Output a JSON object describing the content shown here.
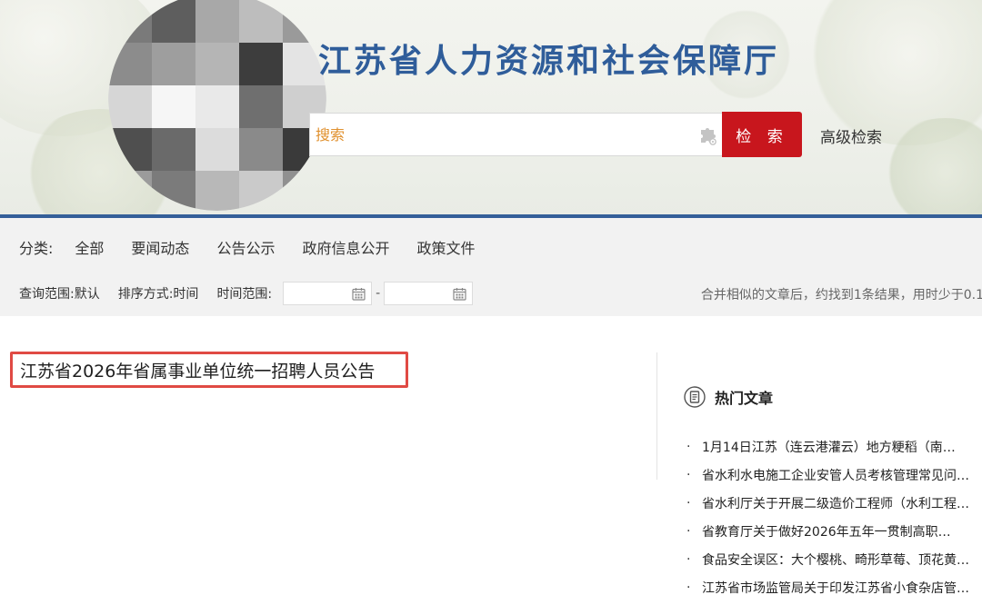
{
  "header": {
    "site_title": "江苏省人力资源和社会保障厅",
    "search": {
      "placeholder": "搜索",
      "button_label": "检 索",
      "advanced_label": "高级检索"
    },
    "logo_colors": [
      "#7a7a7a",
      "#5e5e5e",
      "#a8a8a8",
      "#bdbdbd",
      "#9a9a9a",
      "#8c8c8c",
      "#9e9e9e",
      "#b5b5b5",
      "#3d3d3d",
      "#e4e4e4",
      "#d6d6d6",
      "#f6f6f6",
      "#e9e9e9",
      "#6f6f6f",
      "#cfcfcf",
      "#4f4f4f",
      "#6a6a6a",
      "#dcdcdc",
      "#8a8a8a",
      "#3a3a3a",
      "#9b9b9b",
      "#7b7b7b",
      "#b8b8b8",
      "#cacaca",
      "#909090"
    ]
  },
  "filters": {
    "category_label": "分类:",
    "categories": [
      "全部",
      "要闻动态",
      "公告公示",
      "政府信息公开",
      "政策文件"
    ],
    "scope_label": "查询范围:默认",
    "sort_label": "排序方式:时间",
    "time_label": "时间范围:",
    "date_separator": "-",
    "result_summary": "合并相似的文章后，约找到1条结果，用时少于0.1"
  },
  "results": [
    {
      "title": "江苏省2026年省属事业单位统一招聘人员公告"
    }
  ],
  "hot_articles": {
    "title": "热门文章",
    "bullet": "·",
    "items": [
      "1月14日江苏（连云港灌云）地方粳稻（南…",
      "省水利水电施工企业安管人员考核管理常见问…",
      "省水利厅关于开展二级造价工程师（水利工程…",
      "省教育厅关于做好2026年五年一贯制高职…",
      "食品安全误区：大个樱桃、畸形草莓、顶花黄…",
      "江苏省市场监管局关于印发江苏省小食杂店管…"
    ]
  },
  "colors": {
    "brand_blue": "#345f99",
    "title_blue": "#2f5d9a",
    "search_red": "#c8161d",
    "highlight_red": "#e04a44",
    "placeholder_orange": "#e0902e"
  }
}
